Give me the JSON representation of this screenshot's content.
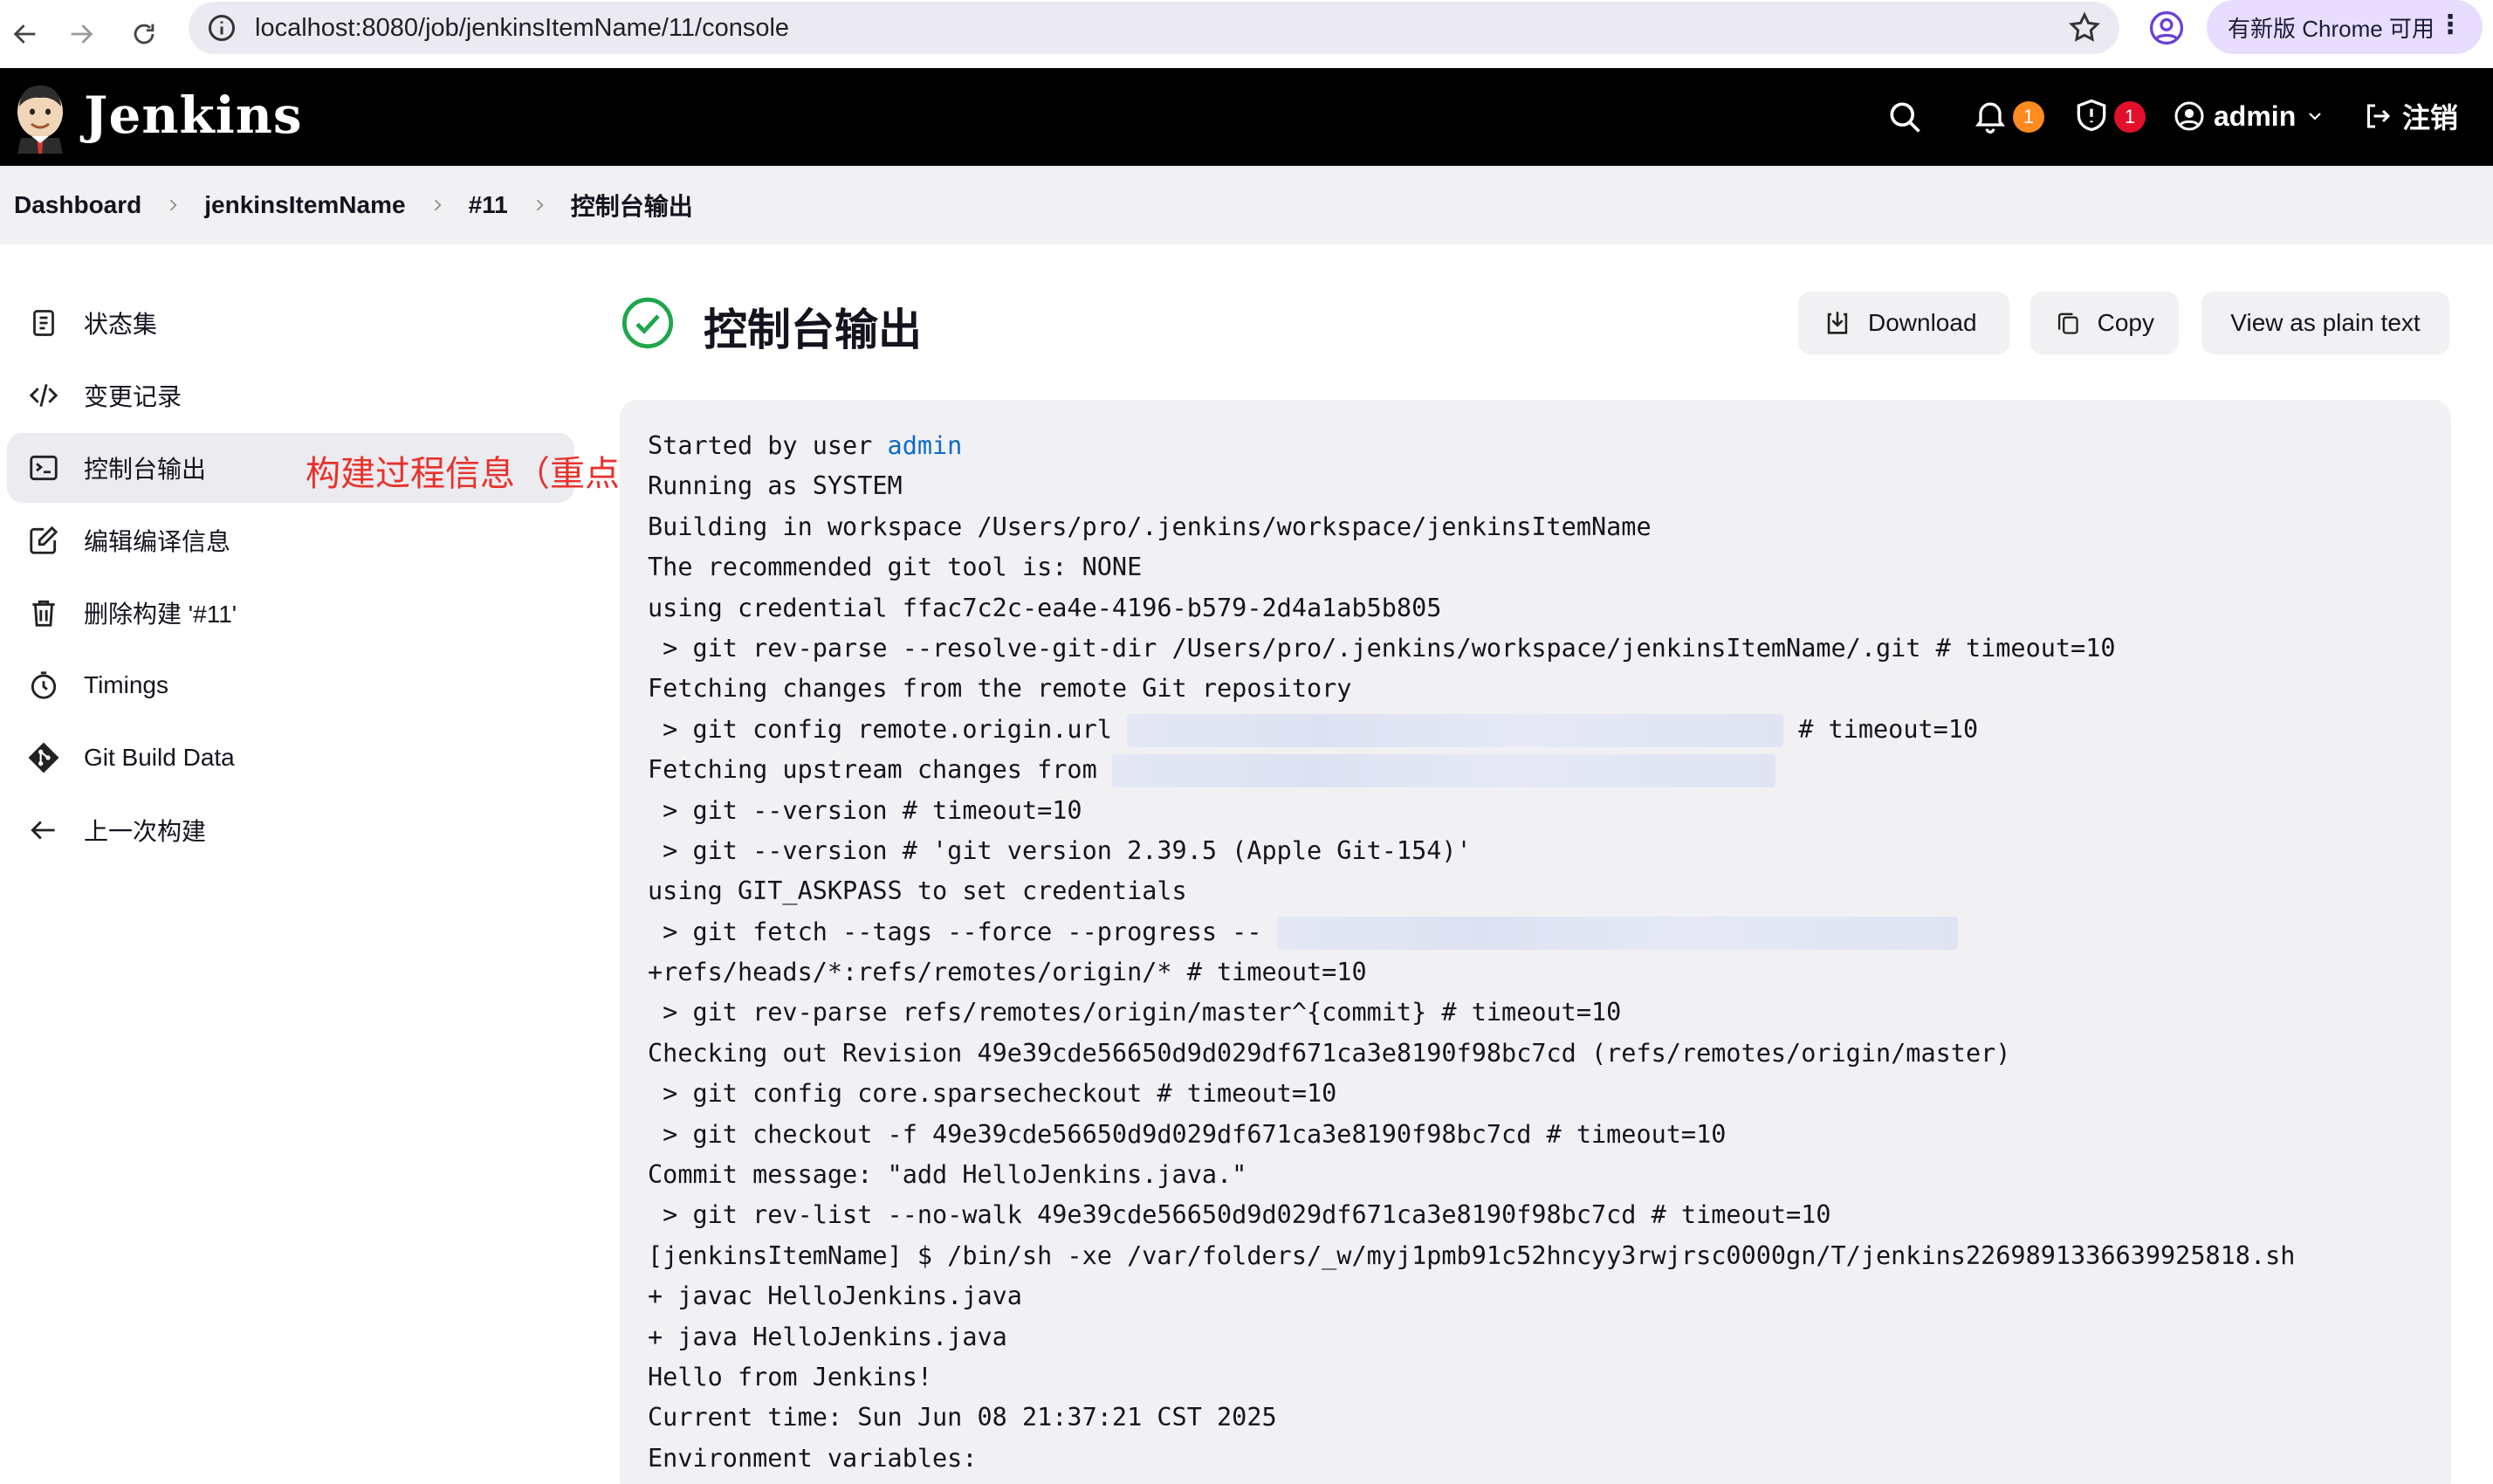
{
  "browser": {
    "url": "localhost:8080/job/jenkinsItemName/11/console",
    "update_label": "有新版 Chrome 可用",
    "icons": [
      "back-arrow-icon",
      "forward-arrow-icon",
      "reload-icon",
      "site-info-icon",
      "bookmark-star-icon",
      "profile-icon",
      "more-vert-icon"
    ]
  },
  "header": {
    "brand": "Jenkins",
    "notifications_count": "1",
    "security_count": "1",
    "user": "admin",
    "logout_label": "注销",
    "colors": {
      "notification_badge": "#ff8a1f",
      "security_badge": "#e3102b"
    }
  },
  "breadcrumb": {
    "items": [
      "Dashboard",
      "jenkinsItemName",
      "#11",
      "控制台输出"
    ]
  },
  "sidebar": {
    "items": [
      {
        "label": "状态集",
        "icon": "status-document-icon"
      },
      {
        "label": "变更记录",
        "icon": "code-icon"
      },
      {
        "label": "控制台输出",
        "icon": "terminal-icon",
        "active": true
      },
      {
        "label": "编辑编译信息",
        "icon": "edit-icon"
      },
      {
        "label": "删除构建 '#11'",
        "icon": "trash-icon"
      },
      {
        "label": "Timings",
        "icon": "stopwatch-icon"
      },
      {
        "label": "Git Build Data",
        "icon": "git-icon"
      },
      {
        "label": "上一次构建",
        "icon": "arrow-left-icon"
      }
    ],
    "annotation": "构建过程信息（重点)"
  },
  "main": {
    "title": "控制台输出",
    "status": "success",
    "status_color": "#1ea64b",
    "download_label": "Download",
    "copy_label": "Copy",
    "plain_label": "View as plain text"
  },
  "console": {
    "started_prefix": "Started by user ",
    "started_user": "admin",
    "lines_a": [
      "Running as SYSTEM",
      "Building in workspace /Users/pro/.jenkins/workspace/jenkinsItemName",
      "The recommended git tool is: NONE",
      "using credential ffac7c2c-ea4e-4196-b579-2d4a1ab5b805",
      " > git rev-parse --resolve-git-dir /Users/pro/.jenkins/workspace/jenkinsItemName/.git # timeout=10",
      "Fetching changes from the remote Git repository"
    ],
    "config_url_prefix": " > git config remote.origin.url ",
    "config_url_suffix": " # timeout=10",
    "fetch_upstream_prefix": "Fetching upstream changes from ",
    "lines_b": [
      " > git --version # timeout=10",
      " > git --version # 'git version 2.39.5 (Apple Git-154)'",
      "using GIT_ASKPASS to set credentials"
    ],
    "fetch_tags_prefix": " > git fetch --tags --force --progress -- ",
    "lines_c": [
      "+refs/heads/*:refs/remotes/origin/* # timeout=10",
      " > git rev-parse refs/remotes/origin/master^{commit} # timeout=10",
      "Checking out Revision 49e39cde56650d9d029df671ca3e8190f98bc7cd (refs/remotes/origin/master)",
      " > git config core.sparsecheckout # timeout=10",
      " > git checkout -f 49e39cde56650d9d029df671ca3e8190f98bc7cd # timeout=10",
      "Commit message: \"add HelloJenkins.java.\"",
      " > git rev-list --no-walk 49e39cde56650d9d029df671ca3e8190f98bc7cd # timeout=10",
      "[jenkinsItemName] $ /bin/sh -xe /var/folders/_w/myj1pmb91c52hncyy3rwjrsc0000gn/T/jenkins2269891336639925818.sh",
      "+ javac HelloJenkins.java",
      "+ java HelloJenkins.java",
      "Hello from Jenkins!",
      "Current time: Sun Jun 08 21:37:21 CST 2025",
      "Environment variables:"
    ]
  }
}
